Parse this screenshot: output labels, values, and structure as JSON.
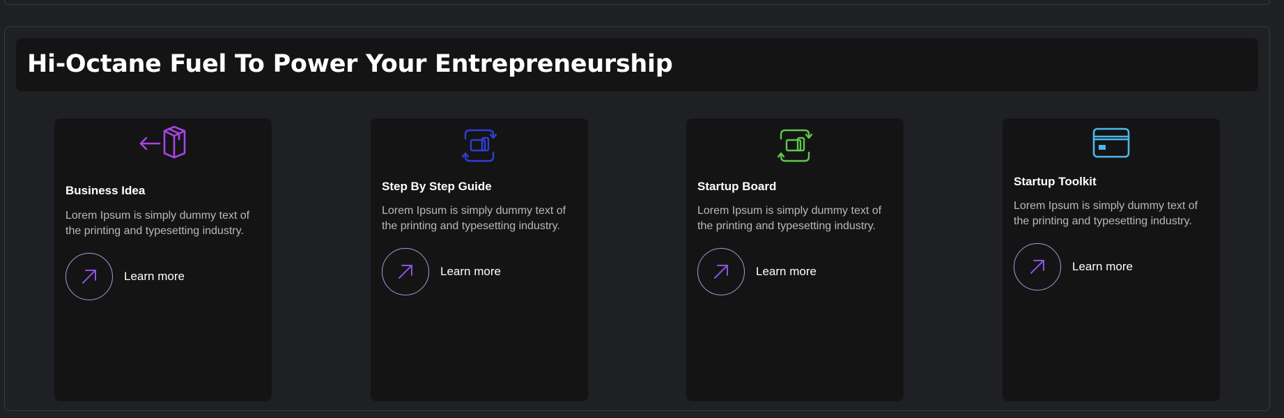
{
  "section": {
    "heading": "Hi-Octane Fuel To Power Your Entrepreneurship"
  },
  "cards": [
    {
      "icon": "box-arrow-icon",
      "icon_color": "#a844e8",
      "title": "Business Idea",
      "description": "Lorem Ipsum is simply dummy text of the printing and typesetting industry.",
      "cta_label": "Learn more"
    },
    {
      "icon": "device-sync-icon",
      "icon_color": "#2d3fd6",
      "title": "Step By Step Guide",
      "description": "Lorem Ipsum is simply dummy text of the printing and typesetting industry.",
      "cta_label": "Learn more"
    },
    {
      "icon": "device-sync-icon",
      "icon_color": "#5fc84a",
      "title": "Startup Board",
      "description": "Lorem Ipsum is simply dummy text of the printing and typesetting industry.",
      "cta_label": "Learn more"
    },
    {
      "icon": "credit-card-icon",
      "icon_color": "#4ab8ec",
      "title": "Startup Toolkit",
      "description": "Lorem Ipsum is simply dummy text of the printing and typesetting industry.",
      "cta_label": "Learn more"
    }
  ],
  "colors": {
    "arrow_accent": "#8a55e0",
    "circle_border": "#a89bd6"
  }
}
